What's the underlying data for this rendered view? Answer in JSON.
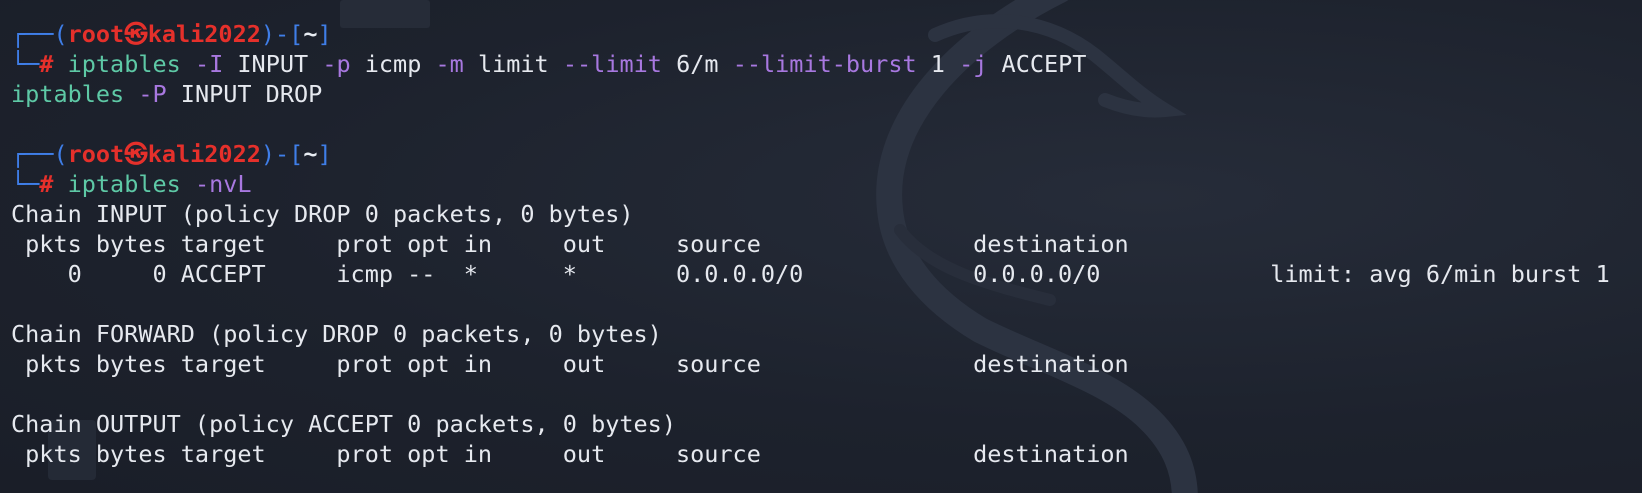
{
  "prompt": {
    "box_top_left": "┌──(",
    "user": "root",
    "skull": "㉿",
    "host": "kali2022",
    "box_mid": ")-[",
    "path": "~",
    "box_end": "]",
    "box_bottom": "└─",
    "hash": "#"
  },
  "cmd1": {
    "command": "iptables",
    "parts": [
      {
        "t": "flag",
        "v": "-I"
      },
      {
        "t": "arg",
        "v": "INPUT"
      },
      {
        "t": "flag",
        "v": "-p"
      },
      {
        "t": "arg",
        "v": "icmp"
      },
      {
        "t": "flag",
        "v": "-m"
      },
      {
        "t": "arg",
        "v": "limit"
      },
      {
        "t": "flag",
        "v": "--limit"
      },
      {
        "t": "arg",
        "v": "6/m"
      },
      {
        "t": "flag",
        "v": "--limit-burst"
      },
      {
        "t": "arg",
        "v": "1"
      },
      {
        "t": "flag",
        "v": "-j"
      },
      {
        "t": "arg",
        "v": "ACCEPT"
      }
    ]
  },
  "cmd1b": {
    "command": "iptables",
    "flag": "-P",
    "args": "INPUT DROP"
  },
  "cmd2": {
    "command": "iptables",
    "flag": "-nvL"
  },
  "output": [
    "Chain INPUT (policy DROP 0 packets, 0 bytes)",
    " pkts bytes target     prot opt in     out     source               destination",
    "    0     0 ACCEPT     icmp --  *      *       0.0.0.0/0            0.0.0.0/0            limit: avg 6/min burst 1",
    "",
    "Chain FORWARD (policy DROP 0 packets, 0 bytes)",
    " pkts bytes target     prot opt in     out     source               destination",
    "",
    "Chain OUTPUT (policy ACCEPT 0 packets, 0 bytes)",
    " pkts bytes target     prot opt in     out     source               destination"
  ]
}
